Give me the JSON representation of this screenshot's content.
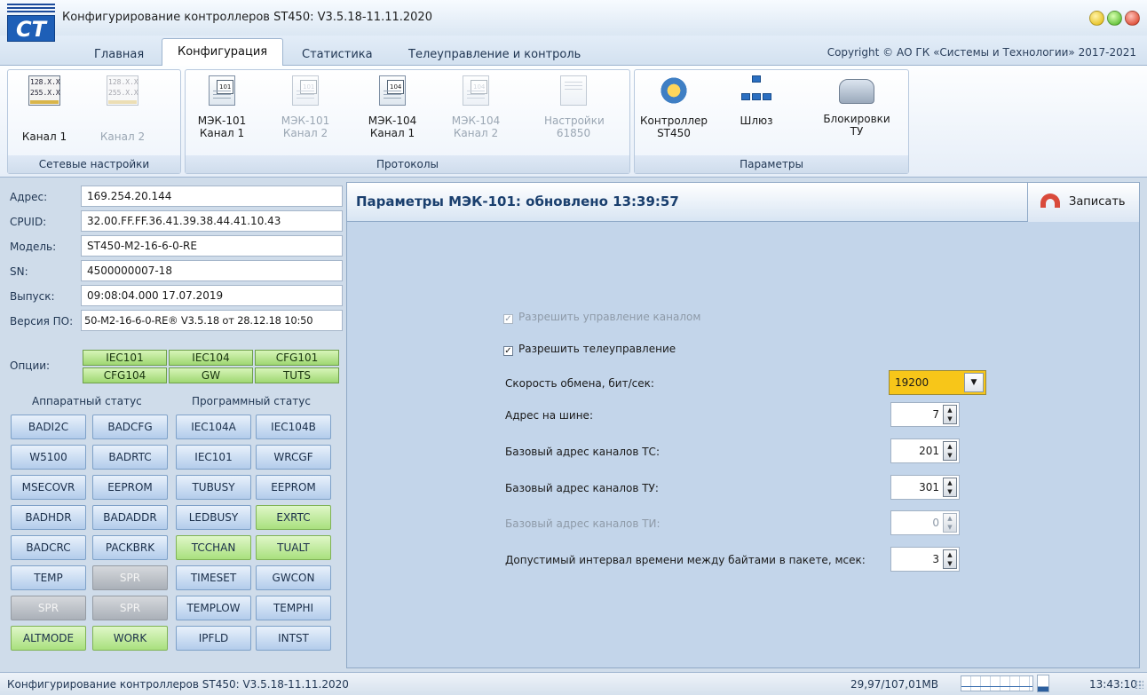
{
  "window": {
    "title": "Конфигурирование контроллеров ST450: V3.5.18-11.11.2020",
    "logo": "CT"
  },
  "tabs": [
    "Главная",
    "Конфигурация",
    "Статистика",
    "Телеуправление и контроль"
  ],
  "active_tab": "Конфигурация",
  "copyright": "Copyright © АО ГК «Системы и Технологии» 2017-2021",
  "ribbon": {
    "network": {
      "label": "Сетевые настройки",
      "buttons": [
        {
          "label": "Канал 1",
          "icon": "network-card-icon",
          "enabled": true,
          "icon_text": "128.X.X\n255.X.X"
        },
        {
          "label": "Канал 2",
          "icon": "network-card-icon",
          "enabled": false,
          "icon_text": "128.X.X\n255.X.X"
        }
      ]
    },
    "protocols": {
      "label": "Протоколы",
      "buttons": [
        {
          "line1": "МЭК-101",
          "line2": "Канал 1",
          "icon": "document-101-icon",
          "tag": "101",
          "enabled": true
        },
        {
          "line1": "МЭК-101",
          "line2": "Канал 2",
          "icon": "document-101-icon",
          "tag": "101",
          "enabled": false
        },
        {
          "line1": "МЭК-104",
          "line2": "Канал 1",
          "icon": "document-104-icon",
          "tag": "104",
          "enabled": true
        },
        {
          "line1": "МЭК-104",
          "line2": "Канал 2",
          "icon": "document-104-icon",
          "tag": "104",
          "enabled": false
        },
        {
          "line1": "Настройки",
          "line2": "61850",
          "icon": "settings-61850-icon",
          "enabled": false
        }
      ]
    },
    "params": {
      "label": "Параметры",
      "buttons": [
        {
          "line1": "Контроллер",
          "line2": "ST450",
          "icon": "controller-gear-icon",
          "enabled": true
        },
        {
          "line1": "Шлюз",
          "line2": "",
          "icon": "gateway-network-icon",
          "enabled": true
        },
        {
          "line1": "Блокировки",
          "line2": "ТУ",
          "icon": "lock-vehicle-icon",
          "enabled": true
        }
      ]
    }
  },
  "device_info": [
    {
      "label": "Адрес:",
      "value": "169.254.20.144"
    },
    {
      "label": "CPUID:",
      "value": "32.00.FF.FF.36.41.39.38.44.41.10.43"
    },
    {
      "label": "Модель:",
      "value": "ST450-M2-16-6-0-RE"
    },
    {
      "label": "SN:",
      "value": "4500000007-18"
    },
    {
      "label": "Выпуск:",
      "value": "09:08:04.000 17.07.2019"
    },
    {
      "label": "Версия ПО:",
      "value": "50-M2-16-6-0-RE® V3.5.18 от 28.12.18 10:50"
    }
  ],
  "options": {
    "label": "Опции:",
    "items": [
      "IEC101",
      "IEC104",
      "CFG101",
      "CFG104",
      "GW",
      "TUTS"
    ]
  },
  "status": {
    "hw_title": "Аппаратный статус",
    "sw_title": "Программный статус",
    "rows": [
      [
        {
          "t": "BADI2C",
          "s": "blue"
        },
        {
          "t": "BADCFG",
          "s": "blue"
        },
        {
          "t": "IEC104A",
          "s": "blue"
        },
        {
          "t": "IEC104B",
          "s": "blue"
        }
      ],
      [
        {
          "t": "W5100",
          "s": "blue"
        },
        {
          "t": "BADRTC",
          "s": "blue"
        },
        {
          "t": "IEC101",
          "s": "blue"
        },
        {
          "t": "WRCGF",
          "s": "blue"
        }
      ],
      [
        {
          "t": "MSECOVR",
          "s": "blue"
        },
        {
          "t": "EEPROM",
          "s": "blue"
        },
        {
          "t": "TUBUSY",
          "s": "blue"
        },
        {
          "t": "EEPROM",
          "s": "blue"
        }
      ],
      [
        {
          "t": "BADHDR",
          "s": "blue"
        },
        {
          "t": "BADADDR",
          "s": "blue"
        },
        {
          "t": "LEDBUSY",
          "s": "blue"
        },
        {
          "t": "EXRTC",
          "s": "green"
        }
      ],
      [
        {
          "t": "BADCRC",
          "s": "blue"
        },
        {
          "t": "PACKBRK",
          "s": "blue"
        },
        {
          "t": "TCCHAN",
          "s": "green"
        },
        {
          "t": "TUALT",
          "s": "green"
        }
      ],
      [
        {
          "t": "TEMP",
          "s": "blue"
        },
        {
          "t": "SPR",
          "s": "gray"
        },
        {
          "t": "TIMESET",
          "s": "blue"
        },
        {
          "t": "GWCON",
          "s": "blue"
        }
      ],
      [
        {
          "t": "SPR",
          "s": "gray"
        },
        {
          "t": "SPR",
          "s": "gray"
        },
        {
          "t": "TEMPLOW",
          "s": "blue"
        },
        {
          "t": "TEMPHI",
          "s": "blue"
        }
      ],
      [
        {
          "t": "ALTMODE",
          "s": "green"
        },
        {
          "t": "WORK",
          "s": "green"
        },
        {
          "t": "IPFLD",
          "s": "blue"
        },
        {
          "t": "INTST",
          "s": "blue"
        }
      ]
    ]
  },
  "panel": {
    "title": "Параметры МЭК-101: обновлено 13:39:57",
    "write_label": "Записать",
    "checkboxes": [
      {
        "label": "Разрешить управление каналом",
        "checked": true,
        "enabled": false
      },
      {
        "label": "Разрешить телеуправление",
        "checked": true,
        "enabled": true
      }
    ],
    "baud": {
      "label": "Скорость обмена, бит/сек:",
      "value": "19200"
    },
    "fields": [
      {
        "label": "Адрес на шине:",
        "value": "7",
        "enabled": true
      },
      {
        "label": "Базовый адрес каналов ТС:",
        "value": "201",
        "enabled": true
      },
      {
        "label": "Базовый адрес каналов ТУ:",
        "value": "301",
        "enabled": true
      },
      {
        "label": "Базовый адрес каналов ТИ:",
        "value": "0",
        "enabled": false
      },
      {
        "label": "Допустимый интервал времени между байтами в пакете, мсек:",
        "value": "3",
        "enabled": true
      }
    ]
  },
  "statusbar": {
    "text": "Конфигурирование контроллеров ST450: V3.5.18-11.11.2020",
    "memory": "29,97/107,01MB",
    "time": "13:43:10"
  }
}
